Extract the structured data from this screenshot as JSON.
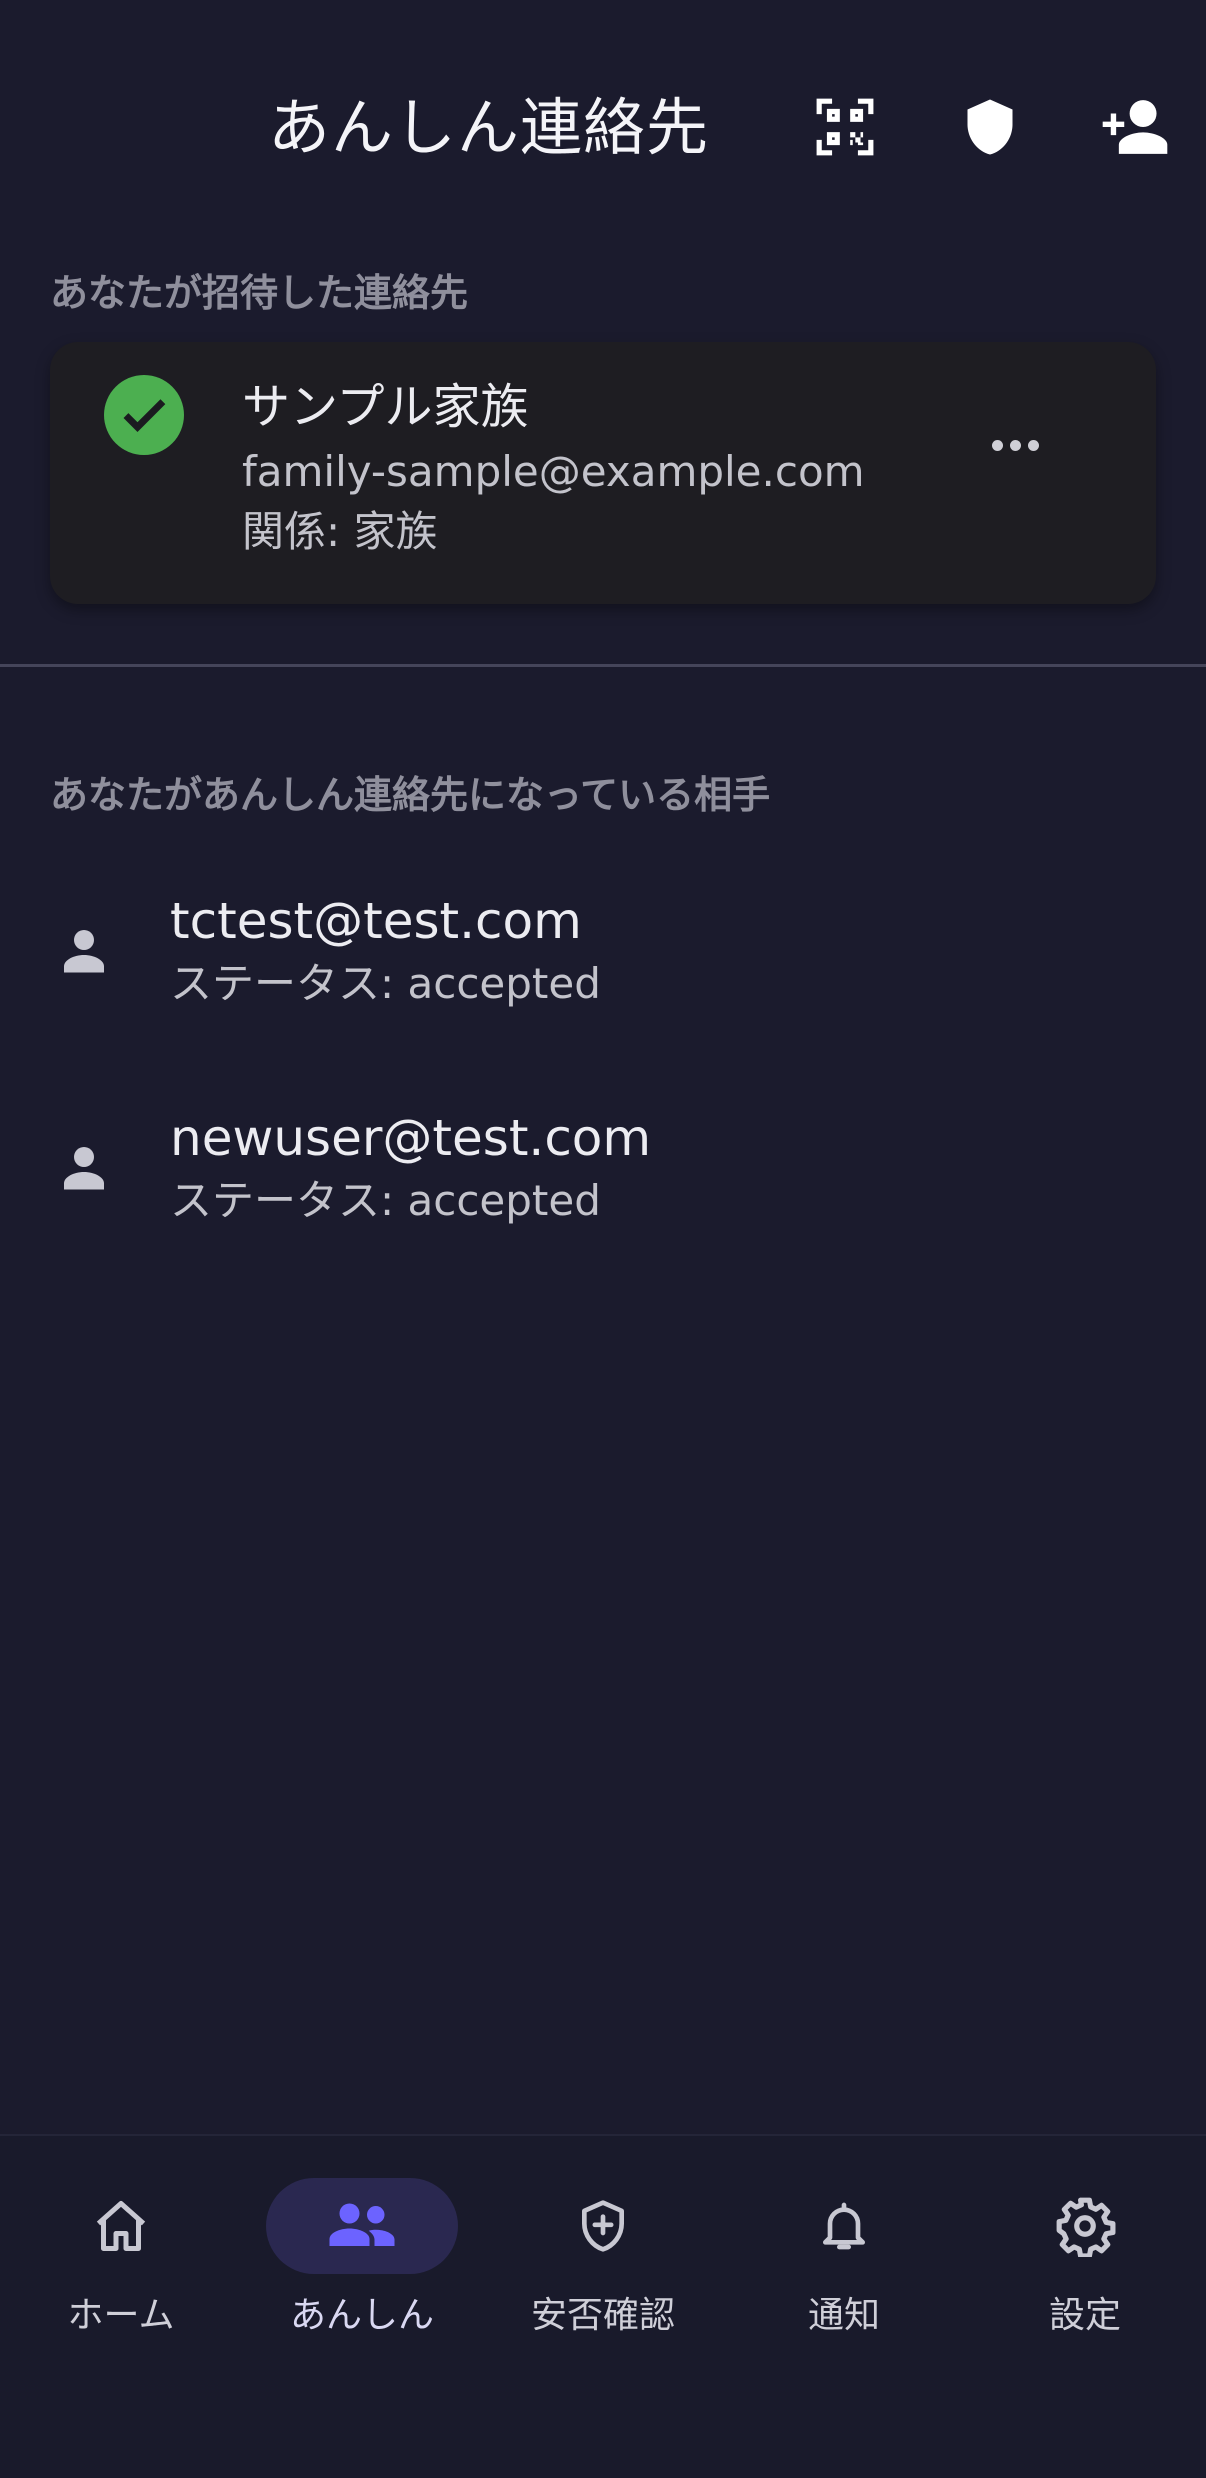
{
  "header": {
    "title": "あんしん連絡先",
    "icons": [
      "qr-code-icon",
      "shield-icon",
      "person-add-icon"
    ]
  },
  "invited": {
    "section_label": "あなたが招待した連絡先",
    "items": [
      {
        "name": "サンプル家族",
        "email": "family-sample@example.com",
        "relation": "関係: 家族",
        "status_icon": "check-circle-icon"
      }
    ]
  },
  "contacts_of": {
    "section_label": "あなたがあんしん連絡先になっている相手",
    "items": [
      {
        "email": "tctest@test.com",
        "status": "ステータス: accepted",
        "icon": "person-icon"
      },
      {
        "email": "newuser@test.com",
        "status": "ステータス: accepted",
        "icon": "person-icon"
      }
    ]
  },
  "bottom_nav": {
    "items": [
      {
        "label": "ホーム",
        "icon": "home-icon",
        "active": false
      },
      {
        "label": "あんしん",
        "icon": "group-icon",
        "active": true
      },
      {
        "label": "安否確認",
        "icon": "shield-plus-icon",
        "active": false
      },
      {
        "label": "通知",
        "icon": "bell-icon",
        "active": false
      },
      {
        "label": "設定",
        "icon": "gear-icon",
        "active": false
      }
    ]
  },
  "colors": {
    "background": "#1b1b2d",
    "card": "#1e1d22",
    "accent": "#6c63ff",
    "success": "#4caf50"
  }
}
